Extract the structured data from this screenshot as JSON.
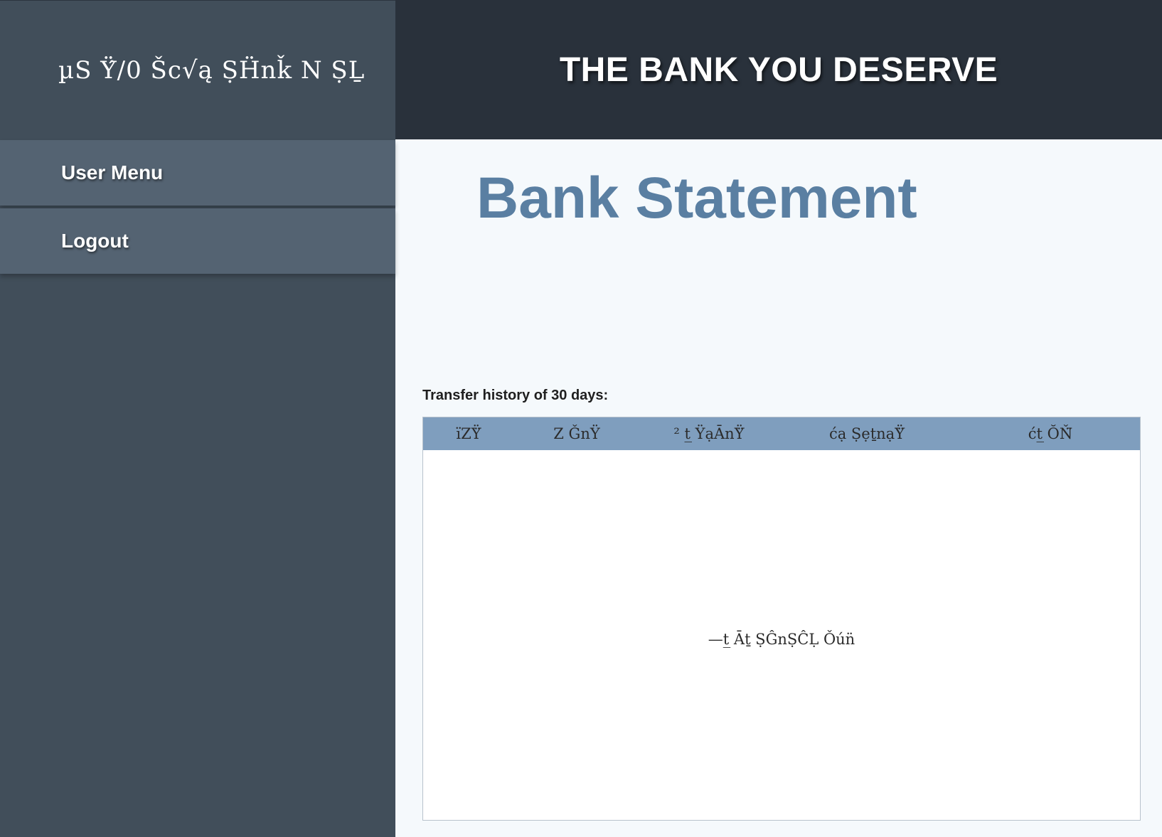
{
  "sidebar": {
    "brand": "µS Ÿ́/0 Šc√ą ṢḦnǩ N ṢḺ",
    "items": [
      {
        "label": "User Menu"
      },
      {
        "label": "Logout"
      }
    ]
  },
  "header": {
    "tagline": "THE BANK YOU DESERVE"
  },
  "main": {
    "title": "Bank Statement",
    "section_label": "Transfer history of 30 days:",
    "table": {
      "columns": [
        "ïZŸ̈",
        "Z ǦnŸ",
        "² t̲ ŸạĀnŸ̈",
        "ćạ ṢẹṯnạŸ̈",
        "ćt̲ ŎŇ̈"
      ],
      "empty_message": "—t̲ Āṯ ṢĜnṢĈḶ Ǒún̈"
    }
  }
}
